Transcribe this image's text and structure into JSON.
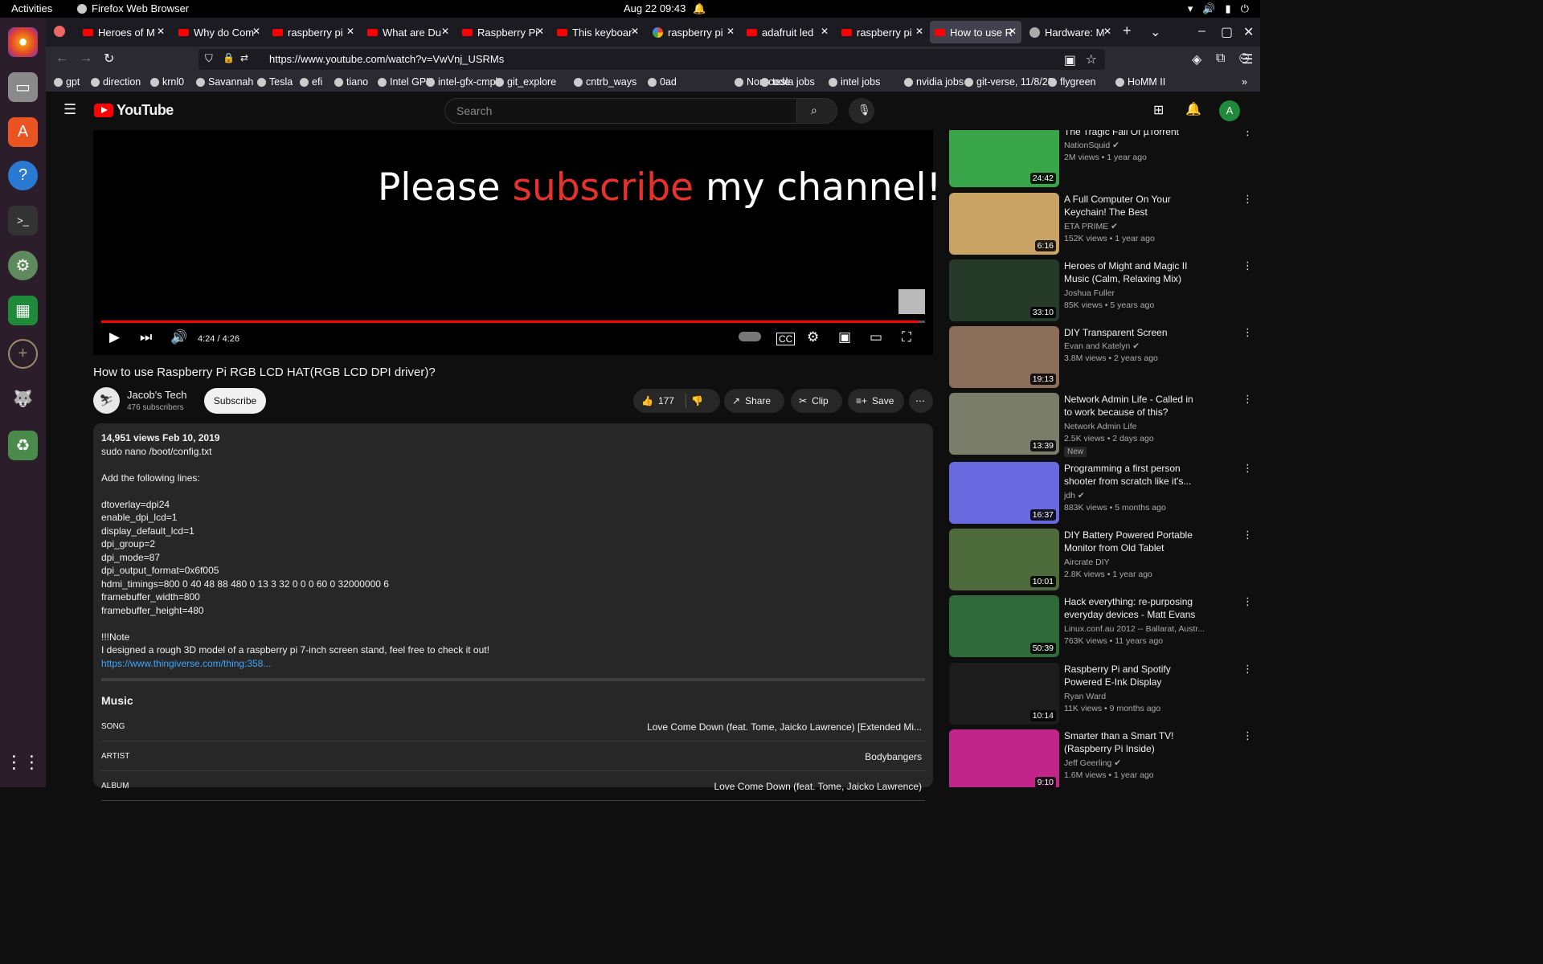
{
  "system": {
    "activities": "Activities",
    "app": "Firefox Web Browser",
    "clock": "Aug 22  09:43"
  },
  "tabs": [
    {
      "label": "Heroes of M",
      "kind": "yt"
    },
    {
      "label": "Why do Com",
      "kind": "yt"
    },
    {
      "label": "raspberry pi",
      "kind": "yt"
    },
    {
      "label": "What are Du",
      "kind": "yt"
    },
    {
      "label": "Raspberry Pi",
      "kind": "yt"
    },
    {
      "label": "This keyboar",
      "kind": "yt"
    },
    {
      "label": "raspberry pi",
      "kind": "gl"
    },
    {
      "label": "adafruit led",
      "kind": "yt"
    },
    {
      "label": "raspberry pi",
      "kind": "yt"
    },
    {
      "label": "How to use R",
      "kind": "yt"
    },
    {
      "label": "Hardware: M",
      "kind": "gh"
    }
  ],
  "url": "https://www.youtube.com/watch?v=VwVnj_USRMs",
  "bookmarks": [
    "gpt",
    "direction",
    "krnl0",
    "Savannah",
    "Tesla",
    "efi",
    "tiano",
    "Intel GPU",
    "intel-gfx-cmpl",
    "git_explore",
    "cntrb_ways",
    "0ad",
    "Non-code",
    "tesla jobs",
    "intel jobs",
    "nvidia jobs",
    "git-verse, 11/8/23",
    "flygreen",
    "HoMM II"
  ],
  "yt": {
    "logo": "YouTube",
    "search_placeholder": "Search",
    "avatar": "A"
  },
  "player": {
    "overlay_a": "Please ",
    "overlay_b": "subscribe",
    "overlay_c": " my channel!",
    "time": "4:24 / 4:26",
    "progress": 0.992
  },
  "video": {
    "title": "How to use Raspberry Pi RGB LCD HAT(RGB LCD DPI driver)?",
    "channel": "Jacob's Tech",
    "subs": "476 subscribers",
    "subscribe": "Subscribe",
    "likes": "177",
    "share": "Share",
    "clip": "Clip",
    "save": "Save"
  },
  "description": {
    "meta": "14,951 views  Feb 10, 2019",
    "lines": [
      "sudo nano /boot/config.txt",
      "",
      "Add the following lines:",
      "",
      "dtoverlay=dpi24",
      "enable_dpi_lcd=1",
      "display_default_lcd=1",
      "dpi_group=2",
      "dpi_mode=87",
      "dpi_output_format=0x6f005",
      "hdmi_timings=800 0 40 48 88 480 0 13 3 32 0 0 0 60 0 32000000 6",
      "framebuffer_width=800",
      "framebuffer_height=480",
      "",
      "!!!Note",
      "I designed a rough 3D model of a raspberry pi 7-inch screen stand, feel free to check it out!"
    ],
    "link": "https://www.thingiverse.com/thing:358...",
    "music_heading": "Music",
    "music": [
      {
        "k": "SONG",
        "v": "Love Come Down (feat. Tome, Jaicko Lawrence) [Extended Mi..."
      },
      {
        "k": "ARTIST",
        "v": "Bodybangers"
      },
      {
        "k": "ALBUM",
        "v": "Love Come Down (feat. Tome, Jaicko Lawrence)"
      }
    ]
  },
  "related": [
    {
      "title": "The Tragic Fall Of µTorrent",
      "channel": "NationSquid",
      "views": "2M views • 1 year ago",
      "dur": "24:42",
      "color": "#3aa64a",
      "verified": true
    },
    {
      "title": "A Full Computer On Your Keychain! The Best Raspberry...",
      "channel": "ETA PRIME",
      "views": "152K views • 1 year ago",
      "dur": "6:16",
      "color": "#c9a465",
      "verified": true
    },
    {
      "title": "Heroes of Might and Magic II Music (Calm, Relaxing Mix)",
      "channel": "Joshua Fuller",
      "views": "85K views • 5 years ago",
      "dur": "33:10",
      "color": "#263a2a",
      "verified": false
    },
    {
      "title": "DIY Transparent Screen",
      "channel": "Evan and Katelyn",
      "views": "3.8M views • 2 years ago",
      "dur": "19:13",
      "color": "#8a6e5a",
      "verified": true
    },
    {
      "title": "Network Admin Life - Called in to work because of this?",
      "channel": "Network Admin Life",
      "views": "2.5K views • 2 days ago",
      "dur": "13:39",
      "color": "#7a7d6a",
      "verified": false,
      "badge": "New"
    },
    {
      "title": "Programming a first person shooter from scratch like it's...",
      "channel": "jdh",
      "views": "883K views • 5 months ago",
      "dur": "16:37",
      "color": "#6a6ae0",
      "verified": true
    },
    {
      "title": "DIY Battery Powered Portable Monitor from Old Tablet",
      "channel": "Aircrate DIY",
      "views": "2.8K views • 1 year ago",
      "dur": "10:01",
      "color": "#4d6a3a",
      "verified": false
    },
    {
      "title": "Hack everything: re-purposing everyday devices - Matt Evans",
      "channel": "Linux.conf.au 2012 -- Ballarat, Austr...",
      "views": "763K views • 11 years ago",
      "dur": "50:39",
      "color": "#2f6a3a",
      "verified": false
    },
    {
      "title": "Raspberry Pi and Spotify Powered E-Ink Display (Tutorial)",
      "channel": "Ryan Ward",
      "views": "11K views • 9 months ago",
      "dur": "10:14",
      "color": "#1c1c1c",
      "verified": false
    },
    {
      "title": "Smarter than a Smart TV! (Raspberry Pi Inside)",
      "channel": "Jeff Geerling",
      "views": "1.6M views • 1 year ago",
      "dur": "9:10",
      "color": "#c2258a",
      "verified": true
    }
  ]
}
